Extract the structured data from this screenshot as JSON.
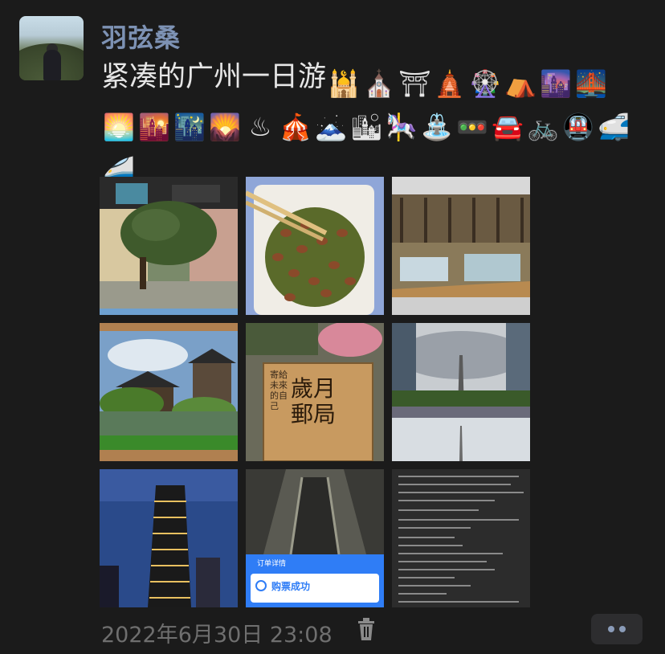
{
  "post": {
    "username": "羽弦桑",
    "text": "紧凑的广州一日游",
    "emojis": [
      {
        "name": "mosque-icon",
        "glyph": "🕌"
      },
      {
        "name": "church-icon",
        "glyph": "⛪"
      },
      {
        "name": "torii-gate-icon",
        "glyph": "⛩"
      },
      {
        "name": "hindu-temple-icon",
        "glyph": "🛕"
      },
      {
        "name": "ferris-wheel-icon",
        "glyph": "🎡"
      },
      {
        "name": "tent-icon",
        "glyph": "⛺"
      },
      {
        "name": "city-dusk-icon",
        "glyph": "🌆"
      },
      {
        "name": "bridge-night-icon",
        "glyph": "🌉"
      },
      {
        "name": "sunrise-icon",
        "glyph": "🌅"
      },
      {
        "name": "city-sunset-icon",
        "glyph": "🌇"
      },
      {
        "name": "night-stars-icon",
        "glyph": "🌃"
      },
      {
        "name": "sunrise-mountains-icon",
        "glyph": "🌄"
      },
      {
        "name": "hot-springs-icon",
        "glyph": "♨"
      },
      {
        "name": "circus-tent-icon",
        "glyph": "🎪"
      },
      {
        "name": "mount-fuji-icon",
        "glyph": "🗻"
      },
      {
        "name": "cityscape-icon",
        "glyph": "🏙"
      },
      {
        "name": "carousel-horse-icon",
        "glyph": "🎠"
      },
      {
        "name": "fountain-icon",
        "glyph": "⛲"
      },
      {
        "name": "traffic-light-icon",
        "glyph": "🚥"
      },
      {
        "name": "car-icon",
        "glyph": "🚘"
      },
      {
        "name": "bicycle-icon",
        "glyph": "🚲"
      },
      {
        "name": "metro-icon",
        "glyph": "🚇"
      },
      {
        "name": "bullet-train-front-icon",
        "glyph": "🚅"
      },
      {
        "name": "bullet-train-icon",
        "glyph": "🚄"
      }
    ],
    "timestamp": "2022年6月30日 23:08",
    "photos": [
      {
        "name": "photo-street-trees"
      },
      {
        "name": "photo-peanut-snack"
      },
      {
        "name": "photo-bookstore"
      },
      {
        "name": "photo-chinese-garden"
      },
      {
        "name": "photo-time-post-office-sign",
        "sign_text": "歲月郵局",
        "sign_small": "寄給未來的自己"
      },
      {
        "name": "photo-canton-tower"
      },
      {
        "name": "photo-skyscraper-night"
      },
      {
        "name": "photo-escalator-ticket",
        "ticket_title": "订单详情",
        "ticket_status": "购票成功"
      },
      {
        "name": "photo-notes-screenshot"
      }
    ]
  },
  "colors": {
    "background": "#1b1b1b",
    "username": "#7d92b4",
    "text": "#e6e6e6",
    "timestamp": "#6f6f6f",
    "more_button_dot": "#8a9bb8"
  }
}
